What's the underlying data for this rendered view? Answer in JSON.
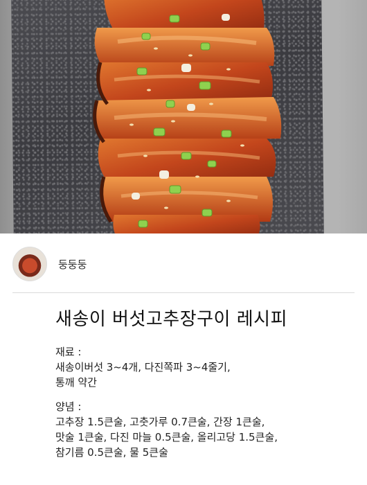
{
  "post": {
    "author": "둥둥둥",
    "title": "새송이 버섯고추장구이 레시피",
    "ingredients": {
      "label": "재료 :",
      "lines": [
        "새송이버섯 3~4개, 다진쪽파 3~4줄기,",
        "통깨 약간"
      ]
    },
    "seasoning": {
      "label": "양념 :",
      "lines": [
        "고추장 1.5큰술, 고춧가루 0.7큰술, 간장 1큰술,",
        "맛술 1큰술, 다진 마늘 0.5큰술, 올리고당 1.5큰술,",
        "참기름 0.5큰술, 물 5큰술"
      ]
    }
  }
}
